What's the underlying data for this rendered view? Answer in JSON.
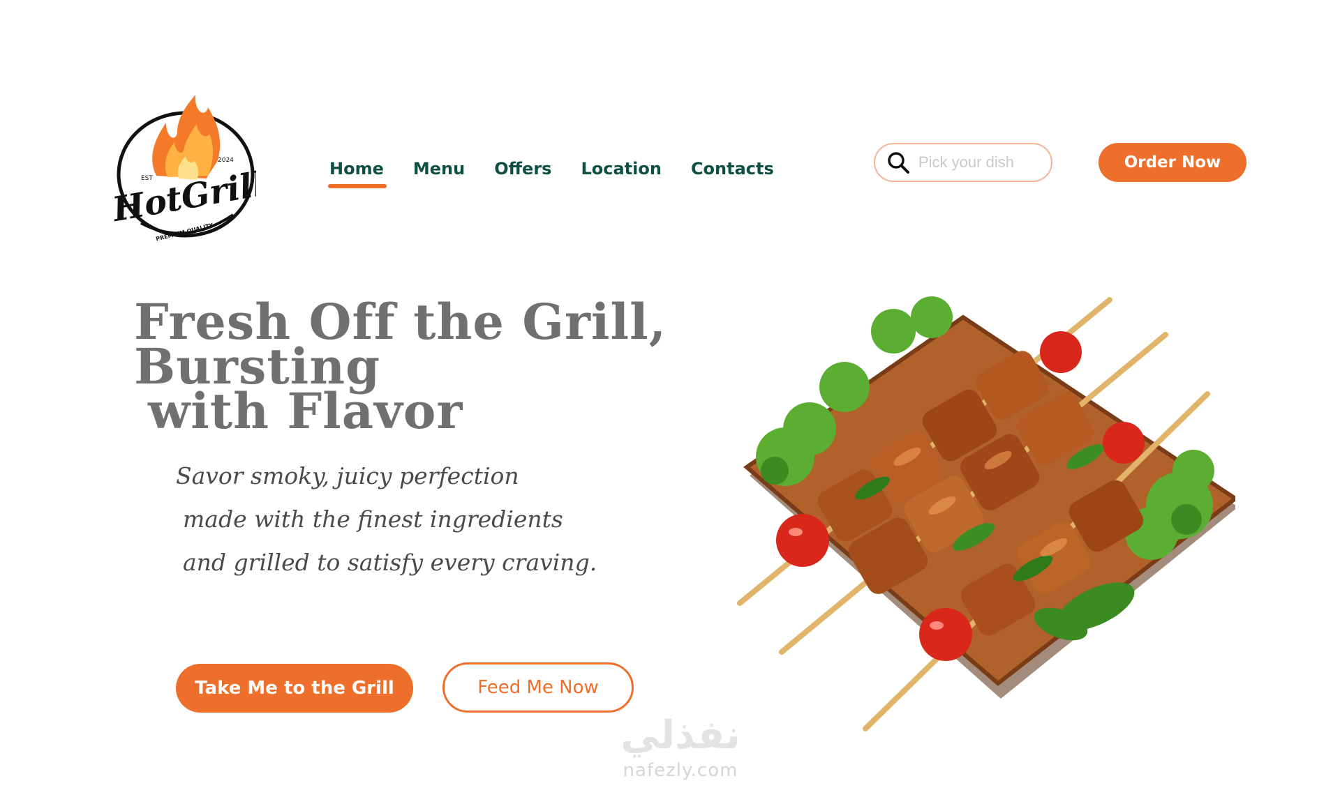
{
  "logo": {
    "brand": "HotGrill",
    "est_left": "EST",
    "est_right": "2024",
    "tagline": "PREMIUM QUALITY"
  },
  "nav": {
    "items": [
      {
        "label": "Home",
        "active": true
      },
      {
        "label": "Menu",
        "active": false
      },
      {
        "label": "Offers",
        "active": false
      },
      {
        "label": "Location",
        "active": false
      },
      {
        "label": "Contacts",
        "active": false
      }
    ]
  },
  "search": {
    "placeholder": "Pick your dish",
    "icon": "search-icon"
  },
  "header": {
    "order_button": "Order Now"
  },
  "hero": {
    "title_line1": "Fresh Off the Grill, Bursting",
    "title_line2": "with Flavor",
    "subtitle_lines": [
      "Savor smoky, juicy perfection",
      "made with the finest ingredients",
      "and grilled to satisfy every craving."
    ],
    "primary_button": "Take Me to the Grill",
    "secondary_button": "Feed Me Now"
  },
  "watermark": {
    "arabic": "نفذلي",
    "latin": "nafezly.com"
  },
  "colors": {
    "accent": "#ee6e2b",
    "nav_text": "#0e4f43",
    "heading": "#707070"
  }
}
